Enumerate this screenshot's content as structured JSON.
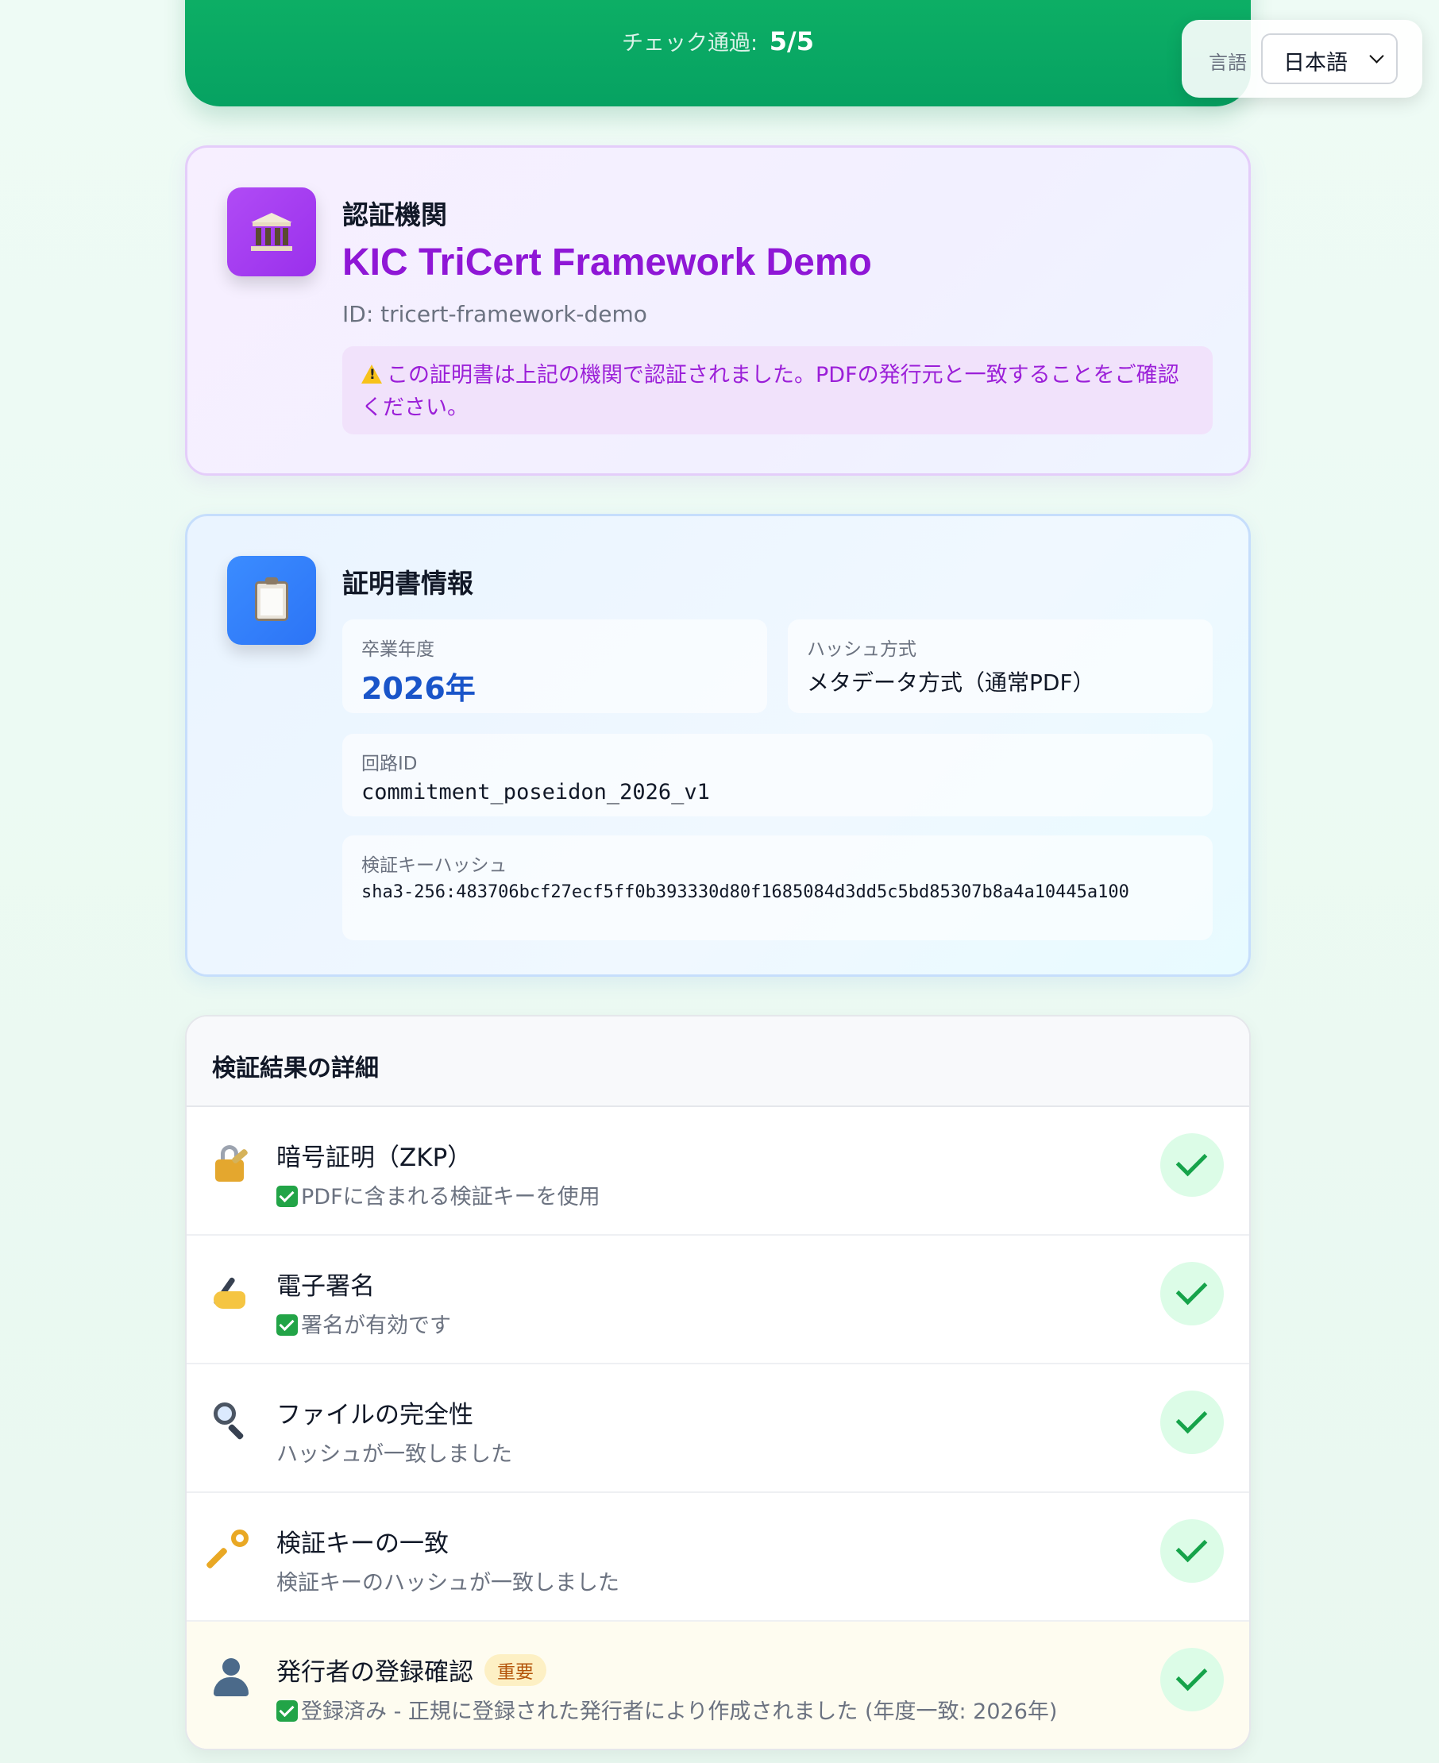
{
  "status": {
    "checks_label": "チェック通過:",
    "checks_value": "5/5"
  },
  "language": {
    "label": "言語",
    "selected": "日本語"
  },
  "authority": {
    "section_label": "認証機関",
    "name": "KIC TriCert Framework Demo",
    "id": "ID: tricert-framework-demo",
    "notice": "この証明書は上記の機関で認証されました。PDFの発行元と一致することをご確認ください。"
  },
  "certificate": {
    "section_label": "証明書情報",
    "graduation_year_label": "卒業年度",
    "graduation_year": "2026年",
    "hash_method_label": "ハッシュ方式",
    "hash_method": "メタデータ方式（通常PDF）",
    "circuit_id_label": "回路ID",
    "circuit_id": "commitment_poseidon_2026_v1",
    "vk_hash_label": "検証キーハッシュ",
    "vk_hash": "sha3-256:483706bcf27ecf5ff0b393330d80f1685084d3dd5c5bd85307b8a4a10445a100"
  },
  "details": {
    "title": "検証結果の詳細",
    "rows": [
      {
        "icon": "lock-with-key-icon",
        "title": "暗号証明（ZKP）",
        "desc": "PDFに含まれる検証キーを使用",
        "ok_mark": true
      },
      {
        "icon": "writing-hand-icon",
        "title": "電子署名",
        "desc": "署名が有効です",
        "ok_mark": true
      },
      {
        "icon": "magnifier-icon",
        "title": "ファイルの完全性",
        "desc": "ハッシュが一致しました",
        "ok_mark": false
      },
      {
        "icon": "key-icon",
        "title": "検証キーの一致",
        "desc": "検証キーのハッシュが一致しました",
        "ok_mark": false
      },
      {
        "icon": "user-icon",
        "title": "発行者の登録確認",
        "badge": "重要",
        "desc": "登録済み - 正規に登録された発行者により作成されました (年度一致: 2026年)",
        "ok_mark": true
      }
    ]
  },
  "colors": {
    "accent_green": "#06a262",
    "authority_purple": "#8f17d6",
    "year_blue": "#1a55c9",
    "pass_green": "#16a34a"
  }
}
